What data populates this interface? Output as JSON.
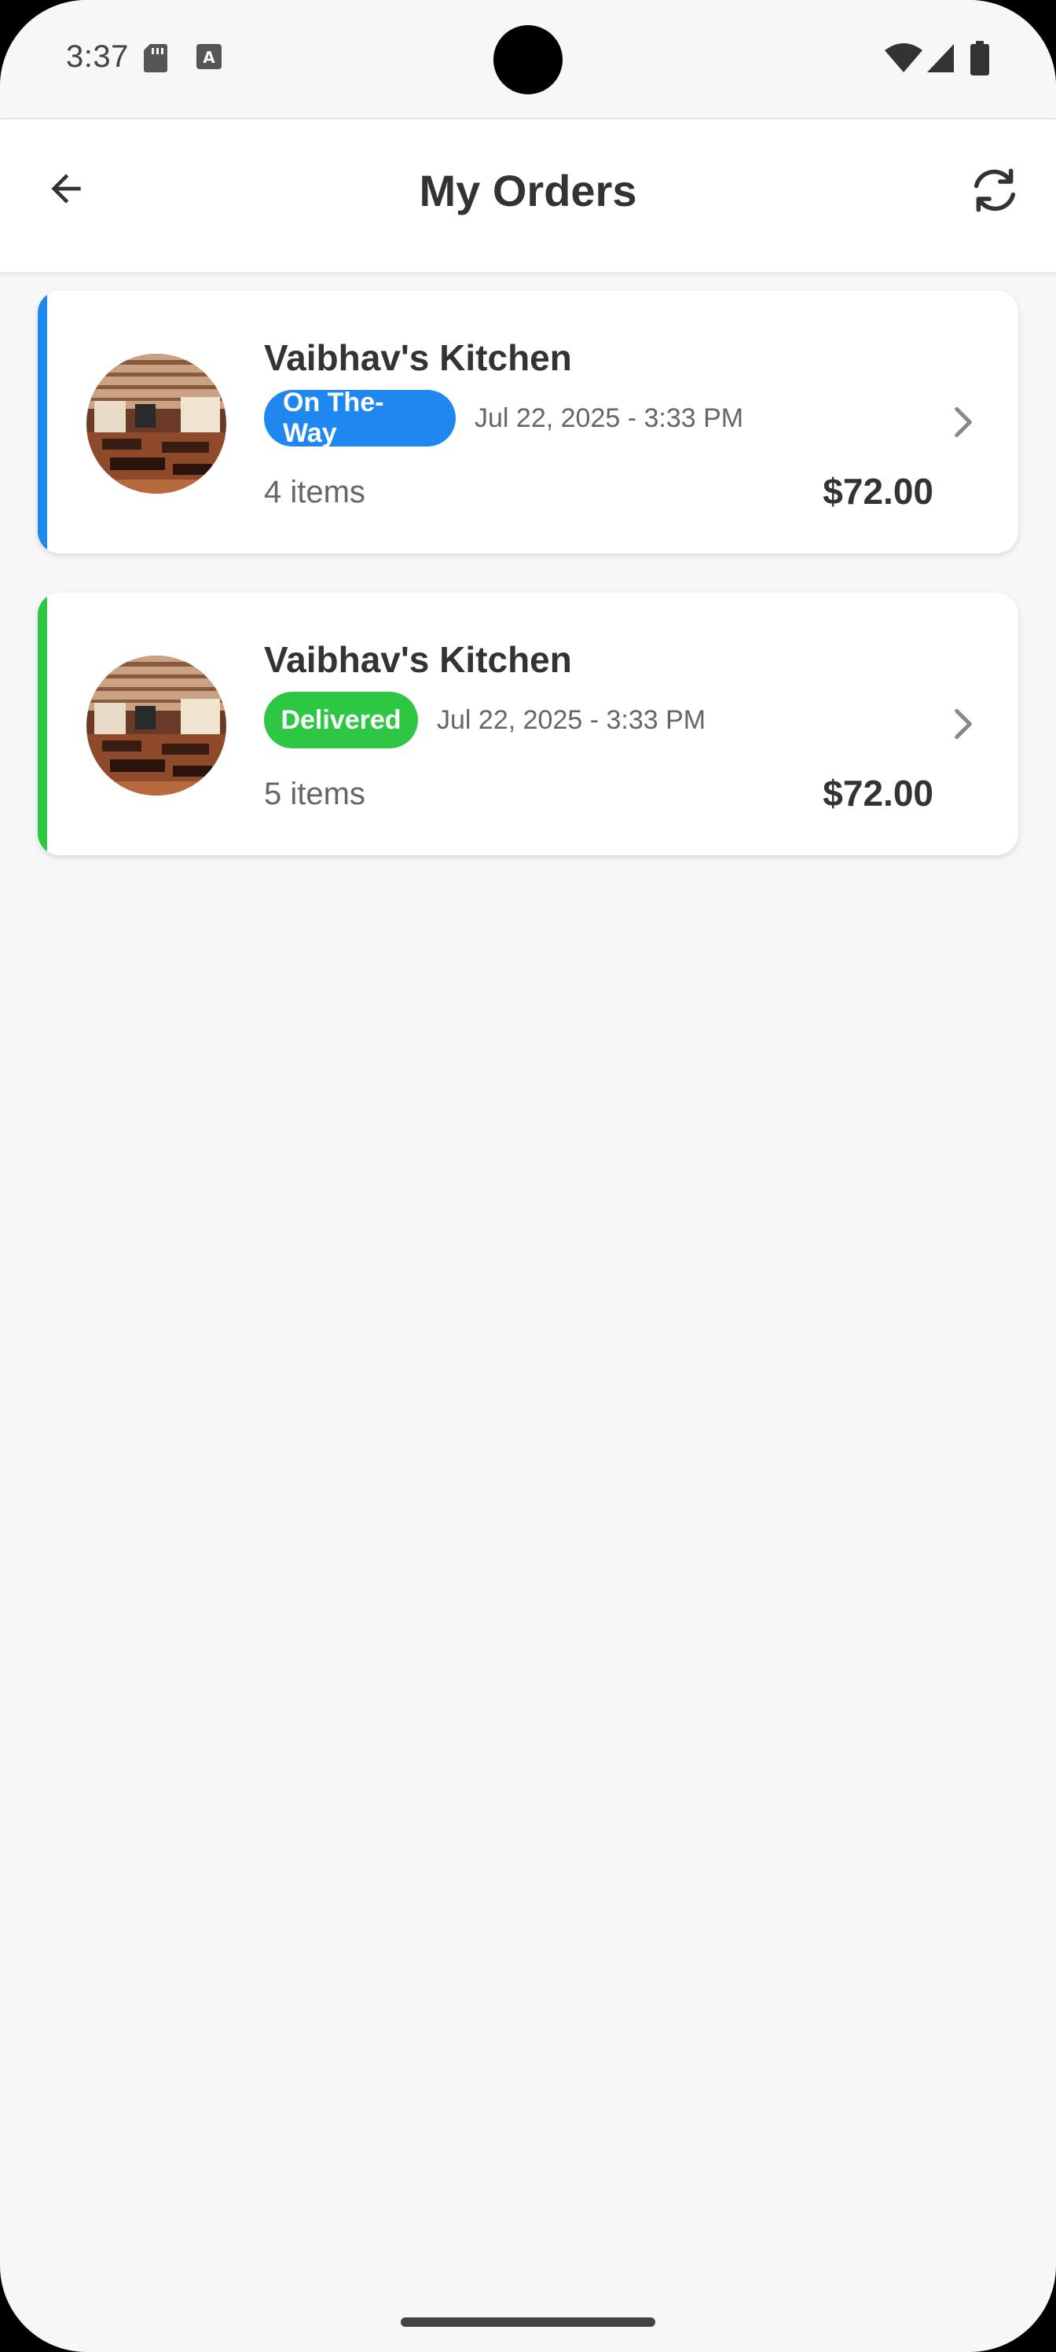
{
  "status_bar": {
    "time": "3:37",
    "left_icons": [
      "sd-card-icon",
      "keyboard-a-icon"
    ],
    "right_icons": [
      "wifi-icon",
      "cell-signal-icon",
      "battery-icon"
    ]
  },
  "app_bar": {
    "title": "My Orders",
    "back_icon": "arrow-left-icon",
    "refresh_icon": "refresh-icon"
  },
  "orders": [
    {
      "restaurant": "Vaibhav's Kitchen",
      "status": "On The-Way",
      "status_color": "#1e88f0",
      "date": "Jul 22, 2025 - 3:33 PM",
      "items": "4 items",
      "total": "$72.00"
    },
    {
      "restaurant": "Vaibhav's Kitchen",
      "status": "Delivered",
      "status_color": "#2ec743",
      "date": "Jul 22, 2025 - 3:33 PM",
      "items": "5 items",
      "total": "$72.00"
    }
  ],
  "colors": {
    "background": "#f7f7f7",
    "card": "#ffffff",
    "text_primary": "#333333",
    "text_secondary": "#666666"
  }
}
